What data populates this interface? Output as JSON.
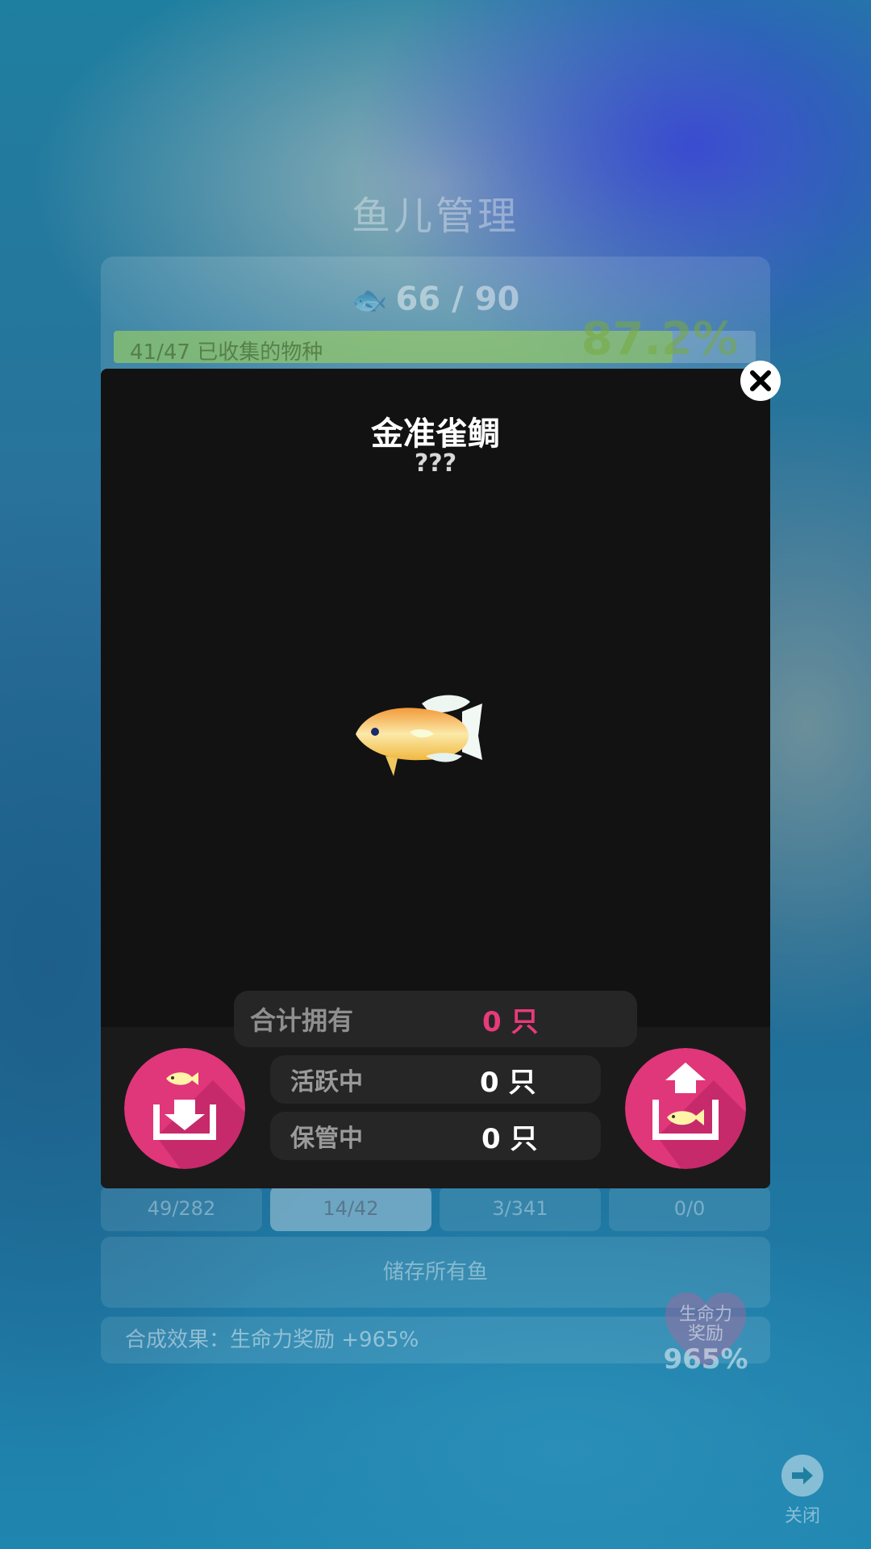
{
  "background": {
    "title": "鱼儿管理",
    "fish_count": "66 / 90",
    "collected_label": "41/47 已收集的物种",
    "collected_fraction": 0.87,
    "collected_percent": "87.2%",
    "tabs": [
      {
        "label": "49/282",
        "active": false
      },
      {
        "label": "14/42",
        "active": true
      },
      {
        "label": "3/341",
        "active": false
      },
      {
        "label": "0/0",
        "active": false
      }
    ],
    "store_all_label": "储存所有鱼",
    "effect_label": "合成效果：生命力奖励 +965%",
    "heart_label": "生命力\n奖励",
    "heart_value": "965%",
    "close_label": "关闭"
  },
  "modal": {
    "fish_name": "金准雀鲷",
    "scientific_name": "???",
    "stats": {
      "total_label": "合计拥有",
      "total_value": "0 只",
      "active_label": "活跃中",
      "active_value": "0 只",
      "storage_label": "保管中",
      "storage_value": "0 只"
    }
  },
  "colors": {
    "accent_pink": "#e0367a",
    "modal_bg": "#121212",
    "total_value": "#e83a7a"
  }
}
